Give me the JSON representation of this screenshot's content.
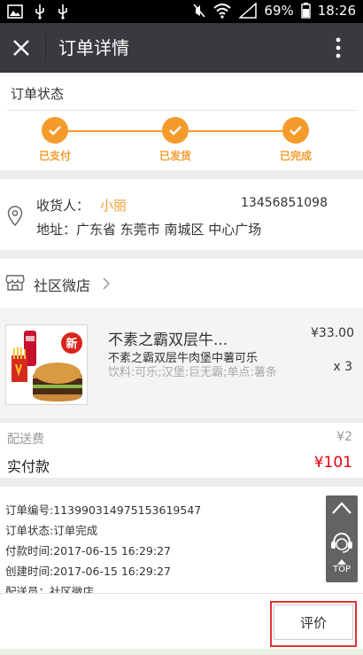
{
  "statusbar": {
    "battery": "69%",
    "time": "18:26",
    "left_icons": [
      "image-icon",
      "usb-icon",
      "usb-icon"
    ],
    "right_icons": [
      "mute-icon",
      "wifi-icon",
      "signal-icon",
      "battery-icon"
    ]
  },
  "titlebar": {
    "title": "订单详情",
    "close_icon": "close-icon",
    "more_icon": "more-vertical-icon"
  },
  "order_status": {
    "label": "订单状态",
    "steps": [
      {
        "label": "已支付",
        "done": true
      },
      {
        "label": "已发货",
        "done": true
      },
      {
        "label": "已完成",
        "done": true
      }
    ],
    "accent": "#f59b2c"
  },
  "address": {
    "receiver_label": "收货人：",
    "receiver_name": "小丽",
    "phone": "13456851098",
    "address": "地址：广东省 东莞市 南城区 中心广场"
  },
  "shop": {
    "name": "社区微店"
  },
  "product": {
    "name": "不素之霸双层牛...",
    "description": "不素之霸双层牛肉堡中薯可乐",
    "spec": "饮料:可乐;汉堡:巨无霸;单点:薯条",
    "price": "¥33.00",
    "quantity": "x 3",
    "badge": "新"
  },
  "fees": {
    "delivery_label": "配送费",
    "delivery_value": "¥2",
    "paid_label": "实付款",
    "paid_value": "¥101",
    "price_color": "#e60012"
  },
  "order_info": {
    "lines": [
      "订单编号:113990314975153619547",
      "订单状态:订单完成",
      "付款时间:2017-06-15 16:29:27",
      "创建时间:2017-06-15 16:29:27",
      "配送员：社区微店"
    ]
  },
  "float_bar": {
    "top_label": "TOP"
  },
  "bottom": {
    "rate_button": "评价"
  }
}
